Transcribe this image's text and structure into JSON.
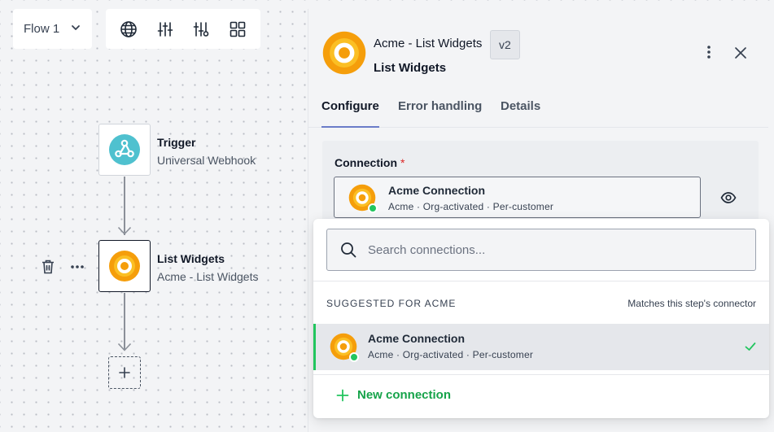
{
  "toolbar": {
    "flow_label": "Flow 1",
    "tools": [
      {
        "icon": "globe-icon"
      },
      {
        "icon": "sliders-vertical-icon"
      },
      {
        "icon": "sliders-filter-icon"
      },
      {
        "icon": "grid-icon"
      }
    ]
  },
  "canvas": {
    "trigger": {
      "title": "Trigger",
      "subtitle": "Universal Webhook",
      "icon": "webhook-icon"
    },
    "step": {
      "title": "List Widgets",
      "subtitle": "Acme - List Widgets",
      "icon": "acme-logo-icon"
    },
    "add_step_icon": "plus-icon"
  },
  "panel": {
    "title": "Acme - List Widgets",
    "version": "v2",
    "subtitle": "List Widgets",
    "tabs": [
      {
        "label": "Configure",
        "active": true
      },
      {
        "label": "Error handling",
        "active": false
      },
      {
        "label": "Details",
        "active": false
      }
    ],
    "connection_field": {
      "label": "Connection",
      "required_mark": "*",
      "selected_name": "Acme Connection",
      "selected_meta": "Acme · Org-activated · Per-customer"
    }
  },
  "dropdown": {
    "search_placeholder": "Search connections...",
    "section_title": "SUGGESTED FOR ACME",
    "section_hint": "Matches this step's connector",
    "option": {
      "name": "Acme Connection",
      "meta": "Acme · Org-activated · Per-customer",
      "selected": true
    },
    "new_label": "New connection"
  },
  "colors": {
    "accent_green": "#22c55e",
    "tab_underline": "#6b7cc8",
    "required_red": "#dc2626",
    "acme_orange": "#f59e0b",
    "webhook_teal": "#4fc1cf"
  }
}
